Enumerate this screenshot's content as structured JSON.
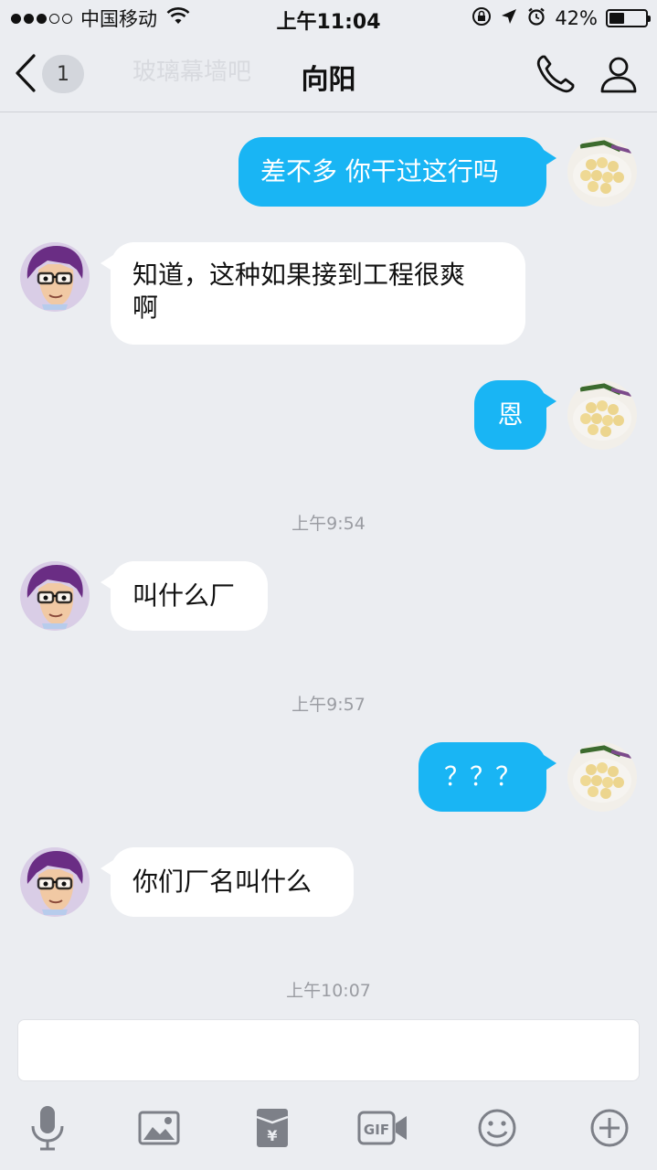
{
  "status_bar": {
    "carrier": "中国移动",
    "time": "上午11:04",
    "battery_percent": "42%",
    "battery_level": 0.42,
    "signal_bars": 3,
    "icons": [
      "wifi-icon",
      "orientation-lock-icon",
      "location-icon",
      "alarm-icon",
      "battery-icon"
    ]
  },
  "nav": {
    "unread_count": "1",
    "ghost_title": "玻璃幕墙吧",
    "title": "向阳",
    "icons": [
      "back-chevron-icon",
      "phone-icon",
      "profile-icon"
    ]
  },
  "messages": [
    {
      "dir": "out",
      "text": "差不多 你干过这行吗"
    },
    {
      "dir": "in",
      "lines": [
        "知道，这种如果接到工程很爽",
        "啊"
      ]
    },
    {
      "dir": "out",
      "text": "恩"
    },
    {
      "timestamp": "上午9:54"
    },
    {
      "dir": "in",
      "text": "叫什么厂"
    },
    {
      "timestamp": "上午9:57"
    },
    {
      "dir": "out",
      "text": "？？？"
    },
    {
      "dir": "in",
      "text": "你们厂名叫什么"
    },
    {
      "timestamp": "上午10:07"
    }
  ],
  "input": {
    "value": "",
    "placeholder": ""
  },
  "toolbar": {
    "icons": [
      "microphone-icon",
      "image-icon",
      "red-packet-icon",
      "gif-icon",
      "emoji-icon",
      "plus-icon"
    ]
  },
  "colors": {
    "background": "#ebedf1",
    "outgoing_bubble": "#19b5f4",
    "incoming_bubble": "#ffffff",
    "timestamp_text": "#9a9ca2",
    "icon_gray": "#7d8088"
  }
}
